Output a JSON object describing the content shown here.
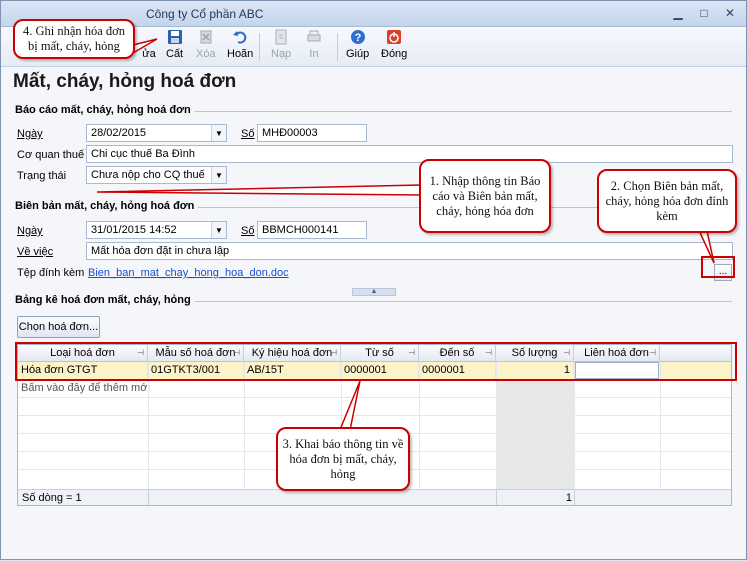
{
  "window": {
    "title": "Công ty Cổ phần ABC"
  },
  "toolbar": {
    "partial_label": "ửa",
    "save": "Cất",
    "delete": "Xóa",
    "undo": "Hoãn",
    "load": "Nạp",
    "print": "In",
    "help": "Giúp",
    "close": "Đóng"
  },
  "page": {
    "title": "Mất, cháy, hỏng hoá đơn"
  },
  "report": {
    "section_title": "Báo cáo mất, cháy, hỏng hoá đơn",
    "date_label": "Ngày",
    "date_value": "28/02/2015",
    "number_label": "Số",
    "number_value": "MHĐ00003",
    "tax_office_label": "Cơ quan thuế",
    "tax_office_value": "Chi cục thuế Ba Đình",
    "status_label": "Trạng thái",
    "status_value": "Chưa nộp cho CQ thuế"
  },
  "minutes": {
    "section_title": "Biên bản mất, cháy, hỏng hoá đơn",
    "date_label": "Ngày",
    "datetime_value": "31/01/2015 14:52",
    "number_label": "Số",
    "number_value": "BBMCH000141",
    "subject_label": "Về việc",
    "subject_value": "Mất hóa đơn đặt in chưa lập",
    "attachment_label": "Tệp đính kèm",
    "attachment_value": "Bien_ban_mat_chay_hong_hoa_don.doc",
    "browse": "..."
  },
  "list": {
    "section_title": "Bảng kê hoá đơn mất, cháy, hỏng",
    "choose_button": "Chọn hoá đơn...",
    "columns": [
      "Loại hoá đơn",
      "Mẫu số hoá đơn",
      "Ký hiệu hoá đơn",
      "Từ số",
      "Đến số",
      "Số lượng",
      "Liên hoá đơn"
    ],
    "rows": [
      {
        "type": "Hóa đơn GTGT",
        "template": "01GTKT3/001",
        "symbol": "AB/15T",
        "from": "0000001",
        "to": "0000001",
        "qty": "1",
        "copy": ""
      }
    ],
    "add_hint": "Bấm vào đây để thêm mới",
    "footer_count": "Số dòng = 1",
    "footer_qty": "1"
  },
  "callouts": {
    "c1": "1. Nhập thông tin Báo cáo và Biên bản mất, cháy, hỏng hóa đơn",
    "c2": "2. Chọn Biên bản mất, cháy, hỏng hóa đơn đính kèm",
    "c3": "3. Khai báo thông tin về hóa đơn bị mất, cháy, hỏng",
    "c4": "4. Ghi nhận hóa đơn bị mất, cháy, hỏng"
  },
  "colors": {
    "accent": "#cc0000",
    "link": "#1a4fd0",
    "selected_row": "#fdf3c8"
  }
}
